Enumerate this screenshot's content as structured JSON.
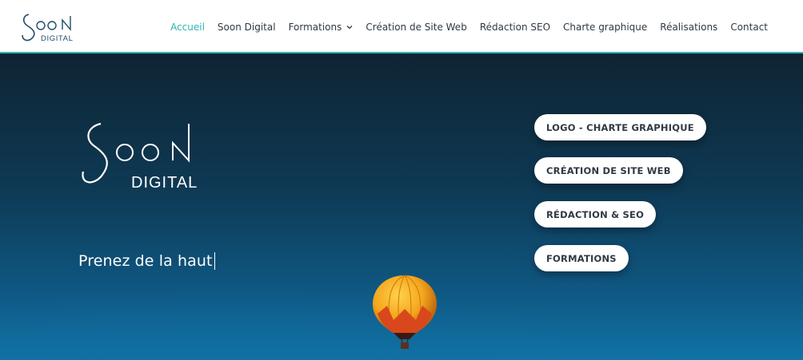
{
  "header": {
    "logo": {
      "text_top": "SooN",
      "text_bottom": "DIGITAL"
    },
    "nav": [
      {
        "label": "Accueil",
        "active": true
      },
      {
        "label": "Soon Digital"
      },
      {
        "label": "Formations",
        "has_dropdown": true,
        "icon": "chevron-down-icon"
      },
      {
        "label": "Création de Site Web"
      },
      {
        "label": "Rédaction SEO"
      },
      {
        "label": "Charte graphique"
      },
      {
        "label": "Réalisations"
      },
      {
        "label": "Contact"
      }
    ],
    "accent_color": "#2fb3b3",
    "text_color": "#2f3a45"
  },
  "hero": {
    "logo": {
      "text_top": "SooN",
      "text_bottom": "DIGITAL"
    },
    "typing_text": "Prenez de la haut",
    "buttons": [
      {
        "label": "LOGO - CHARTE GRAPHIQUE"
      },
      {
        "label": "CRÉATION DE SITE WEB"
      },
      {
        "label": "RÉDACTION & SEO"
      },
      {
        "label": "FORMATIONS"
      }
    ],
    "image": "hot-air-balloon",
    "background_colors": [
      "#0f2433",
      "#0e3a55",
      "#1173a6"
    ]
  }
}
